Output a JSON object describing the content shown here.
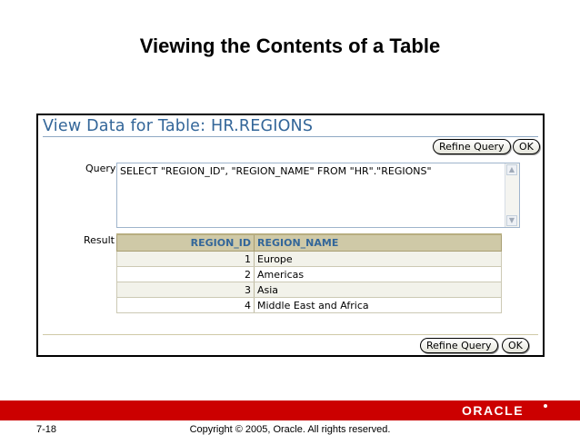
{
  "slide": {
    "title": "Viewing the Contents of a Table",
    "page_number": "7-18",
    "copyright": "Copyright © 2005, Oracle.  All rights reserved.",
    "logo": "ORACLE"
  },
  "panel": {
    "title": "View Data for Table: HR.REGIONS",
    "refine_query_label": "Refine Query",
    "ok_label": "OK",
    "query_label": "Query",
    "query_text": "SELECT \"REGION_ID\", \"REGION_NAME\" FROM \"HR\".\"REGIONS\"",
    "result_label": "Result"
  },
  "result": {
    "columns": [
      "REGION_ID",
      "REGION_NAME"
    ],
    "rows": [
      {
        "id": "1",
        "name": "Europe"
      },
      {
        "id": "2",
        "name": "Americas"
      },
      {
        "id": "3",
        "name": "Asia"
      },
      {
        "id": "4",
        "name": "Middle East and Africa"
      }
    ]
  },
  "colors": {
    "accent": "#336699",
    "header_bg": "#cfc9a7",
    "footer_red": "#cc0000"
  },
  "icons": [
    "scroll-up-icon",
    "scroll-down-icon"
  ]
}
